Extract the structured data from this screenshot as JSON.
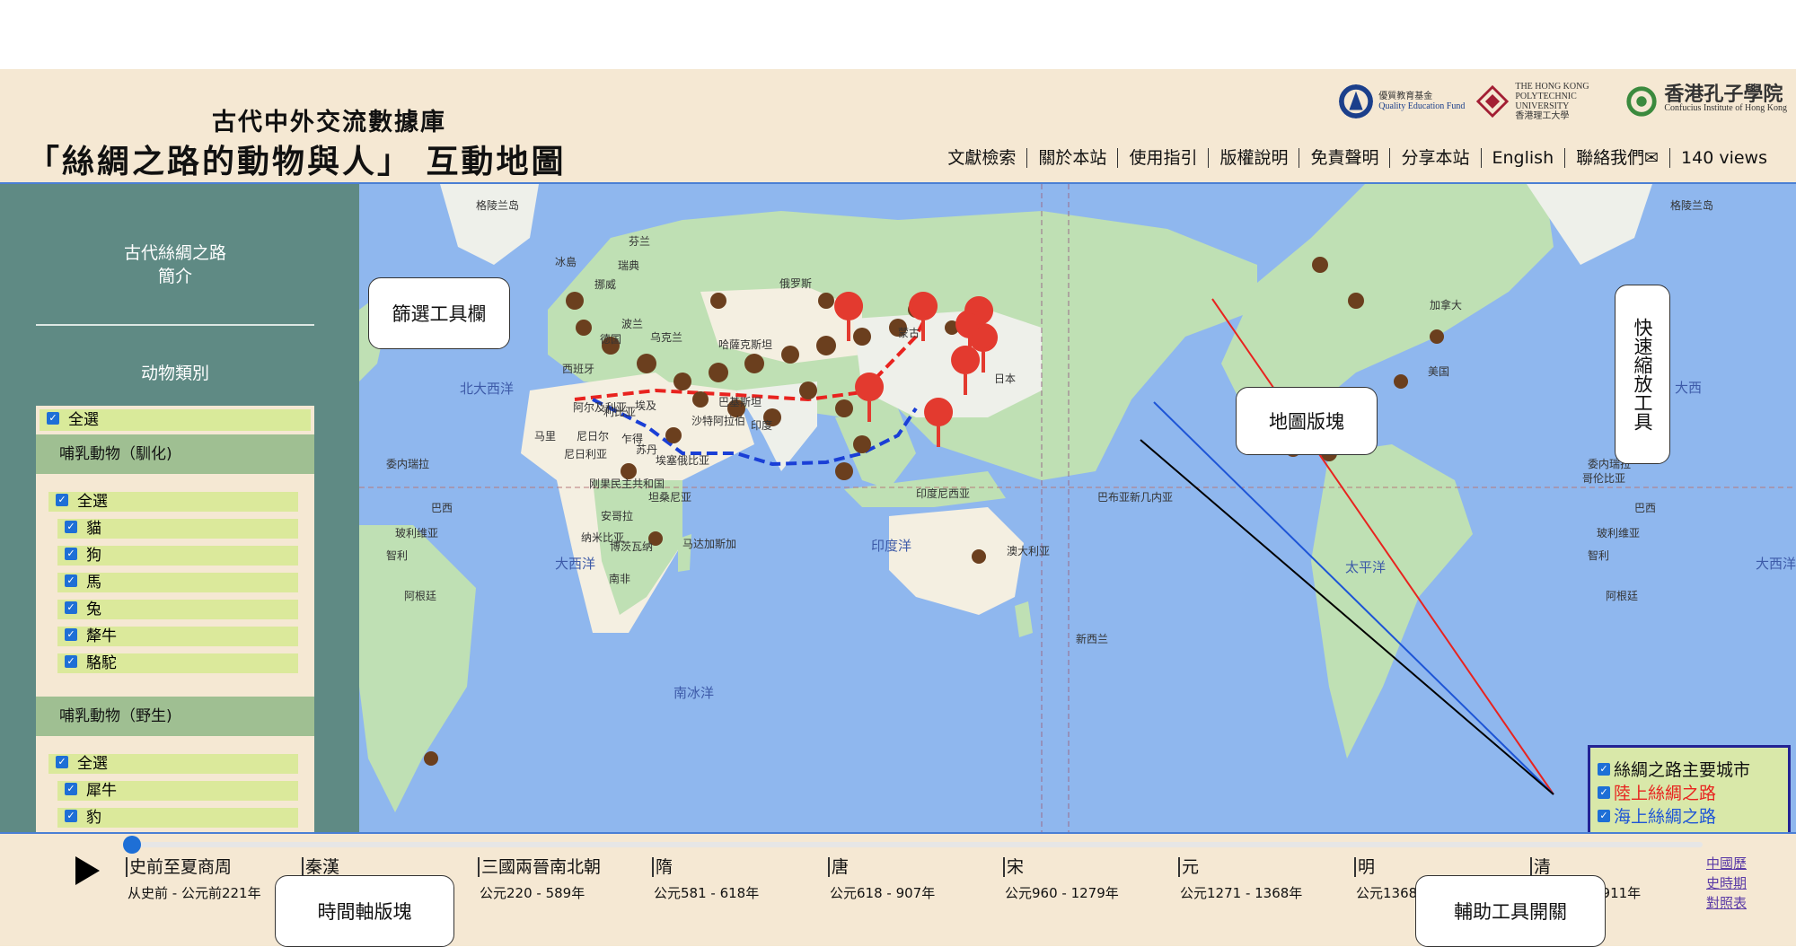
{
  "header": {
    "title_line1": "古代中外交流數據庫",
    "title_line2": "「絲綢之路的動物與人」 互動地圖",
    "logos": [
      {
        "name": "Quality Education Fund",
        "text_zh": "優質教育基金",
        "text_en": "Quality Education Fund",
        "color": "#1b3f8b"
      },
      {
        "name": "The Hong Kong Polytechnic University",
        "text_zh": "香港理工大學",
        "text_en": "THE HONG KONG POLYTECHNIC UNIVERSITY",
        "color": "#a31f34"
      },
      {
        "name": "Confucius Institute of Hong Kong",
        "text_zh": "香港孔子學院",
        "text_en": "Confucius Institute of Hong Kong",
        "color": "#3b8a3e"
      }
    ],
    "nav": [
      "文獻檢索",
      "關於本站",
      "使用指引",
      "版權說明",
      "免責聲明",
      "分享本站",
      "English",
      "聯絡我們✉",
      "140 views"
    ]
  },
  "sidebar": {
    "intro_line1": "古代絲綢之路",
    "intro_line2": "簡介",
    "category_title": "动物類別",
    "select_all": "全選",
    "groups": [
      {
        "title": "哺乳動物（馴化)",
        "select_all": "全選",
        "items": [
          "貓",
          "狗",
          "馬",
          "兔",
          "犛牛",
          "駱駝"
        ]
      },
      {
        "title": "哺乳動物（野生)",
        "select_all": "全選",
        "items": [
          "犀牛",
          "豹"
        ]
      }
    ]
  },
  "map": {
    "labels": {
      "greenland_l": "格陵兰岛",
      "greenland_r": "格陵兰岛",
      "iceland": "冰島",
      "finland": "芬兰",
      "sweden": "瑞典",
      "norway": "挪威",
      "poland": "波兰",
      "germany": "德国",
      "ukraine": "乌克兰",
      "spain": "西班牙",
      "russia": "俄罗斯",
      "kazakhstan": "哈薩克斯坦",
      "mongolia": "蒙古",
      "japan": "日本",
      "algeria": "阿尔及利亚",
      "libya": "利比亚",
      "egypt": "埃及",
      "saudi": "沙特阿拉伯",
      "pakistan": "巴基斯坦",
      "india": "印度",
      "mali": "马里",
      "niger": "尼日尔",
      "chad": "乍得",
      "sudan": "苏丹",
      "nigeria": "尼日利亚",
      "ethiopia": "埃塞俄比亚",
      "drc": "刚果民主共和国",
      "tanzania": "坦桑尼亚",
      "angola": "安哥拉",
      "namibia": "纳米比亚",
      "botswana": "博茨瓦纳",
      "south_africa": "南非",
      "madagascar": "马达加斯加",
      "indonesia": "印度尼西亚",
      "png": "巴布亚新几内亚",
      "australia": "澳大利亚",
      "new_zealand": "新西兰",
      "canada": "加拿大",
      "usa": "美国",
      "venezuela_l": "委内瑞拉",
      "venezuela_r": "委内瑞拉",
      "colombia": "哥伦比亚",
      "brazil_l": "巴西",
      "brazil_r": "巴西",
      "bolivia_l": "玻利维亚",
      "bolivia_r": "玻利维亚",
      "chile_l": "智利",
      "chile_r": "智利",
      "argentina_l": "阿根廷",
      "argentina_r": "阿根廷",
      "north_atlantic": "北大西洋",
      "atlantic_l": "大西洋",
      "atlantic_r": "大西洋",
      "indian_ocean": "印度洋",
      "pacific": "太平洋",
      "southern_ocean": "南冰洋",
      "atlantic_cut": "大西"
    },
    "zoom": {
      "plus": "+",
      "minus": "-",
      "level": 0.1
    },
    "aux_toggles": [
      {
        "label": "絲綢之路主要城市",
        "color": "#111111",
        "checked": true
      },
      {
        "label": "陸上絲綢之路",
        "color": "#e8231f",
        "checked": true
      },
      {
        "label": "海上絲綢之路",
        "color": "#1e55d6",
        "checked": true
      }
    ],
    "colors": {
      "ocean": "#8fb7ee",
      "land": "#bfe0b4",
      "land_pale": "#eef0ea",
      "desert": "#f4efe1",
      "pin": "#e33a2f",
      "land_route": "#e8231f",
      "sea_route": "#1a3fd6"
    }
  },
  "callouts": {
    "filter": "篩選工具欄",
    "map_block": "地圖版塊",
    "zoom_tool": "快速縮放工具",
    "timeline": "時間軸版塊",
    "aux": "輔助工具開關"
  },
  "timeline": {
    "progress": 0.0,
    "eras": [
      {
        "name": "史前至夏商周",
        "range": "从史前 - 公元前221年"
      },
      {
        "name": "秦漢",
        "range": ""
      },
      {
        "name": "三國兩晉南北朝",
        "range": "公元220 - 589年"
      },
      {
        "name": "隋",
        "range": "公元581 - 618年"
      },
      {
        "name": "唐",
        "range": "公元618 - 907年"
      },
      {
        "name": "宋",
        "range": "公元960 - 1279年"
      },
      {
        "name": "元",
        "range": "公元1271 - 1368年"
      },
      {
        "name": "明",
        "range": "公元1368"
      },
      {
        "name": "清",
        "range": "1911年"
      }
    ],
    "chronology_link": [
      "中國歷",
      "史時期",
      "對照表"
    ]
  }
}
